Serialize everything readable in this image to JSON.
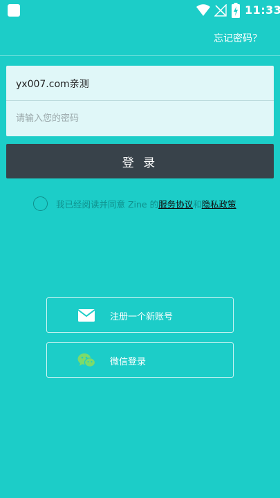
{
  "status_bar": {
    "time": "11:33"
  },
  "top": {
    "forgot_password": "忘记密码？"
  },
  "form": {
    "username_value": "yx007.com亲测",
    "password_placeholder": "请输入您的密码",
    "login_label": "登 录"
  },
  "agreement": {
    "prefix": "我已经阅读并同意 Zine 的",
    "terms": "服务协议",
    "joiner": "和",
    "privacy": "隐私政策"
  },
  "actions": {
    "register_label": "注册一个新账号",
    "wechat_label": "微信登录"
  },
  "icons": {
    "notification": "notification-icon",
    "wifi": "wifi-icon",
    "signal": "signal-off-icon",
    "battery": "battery-charging-icon",
    "mail": "mail-icon",
    "wechat": "wechat-icon"
  },
  "colors": {
    "background": "#1ccdc8",
    "button_dark": "#38424a",
    "input_bg": "#e0f7f8",
    "wechat_green": "#7ddb6a"
  }
}
